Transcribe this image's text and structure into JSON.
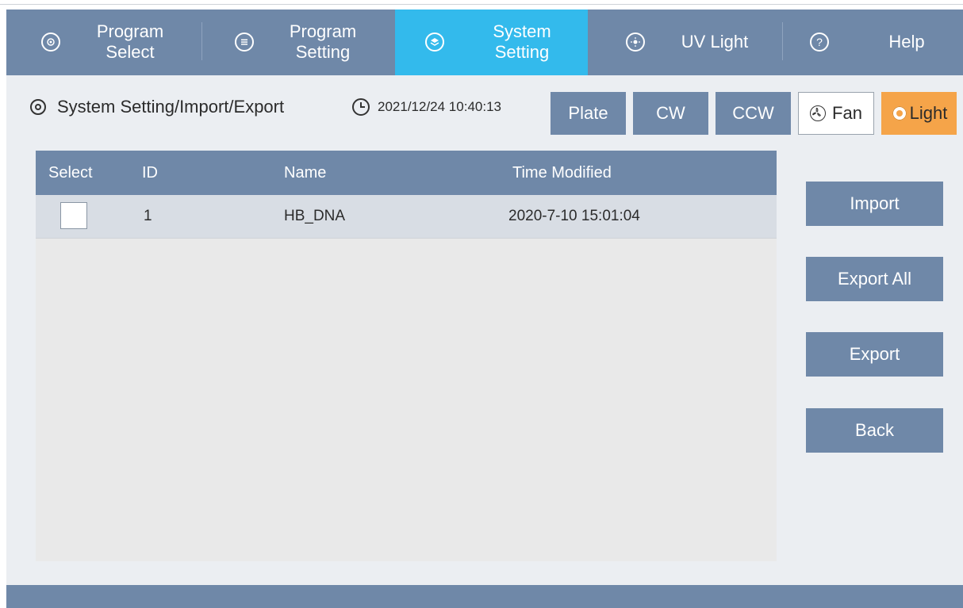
{
  "nav": {
    "tabs": [
      {
        "label_line1": "Program",
        "label_line2": "Select",
        "icon": "crosshair-icon"
      },
      {
        "label_line1": "Program",
        "label_line2": "Setting",
        "icon": "list-icon"
      },
      {
        "label_line1": "System",
        "label_line2": "Setting",
        "icon": "layers-icon",
        "active": true
      },
      {
        "label": "UV Light",
        "icon": "sun-icon"
      },
      {
        "label": "Help",
        "icon": "help-icon"
      }
    ]
  },
  "header": {
    "breadcrumb": "System Setting/Import/Export",
    "datetime": "2021/12/24 10:40:13",
    "buttons": {
      "plate": "Plate",
      "cw": "CW",
      "ccw": "CCW",
      "fan": "Fan",
      "light": "Light"
    }
  },
  "table": {
    "columns": [
      "Select",
      "ID",
      "Name",
      "Time Modified"
    ],
    "rows": [
      {
        "checked": false,
        "id": "1",
        "name": "HB_DNA",
        "time_modified": "2020-7-10 15:01:04"
      }
    ]
  },
  "actions": {
    "import": "Import",
    "export_all": "Export All",
    "export": "Export",
    "back": "Back"
  },
  "colors": {
    "nav_bg": "#6f88a8",
    "nav_active": "#33baec",
    "light_button": "#f5a449",
    "page_bg": "#ebeef2"
  }
}
